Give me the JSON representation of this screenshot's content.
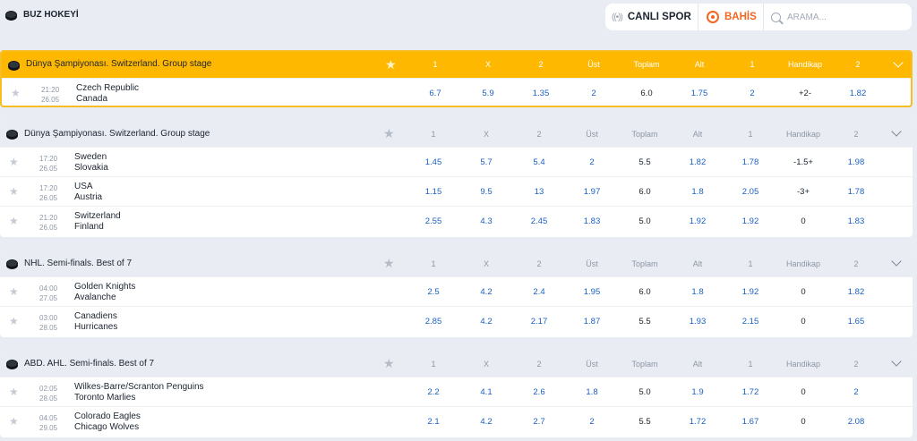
{
  "header": {
    "sport": "BUZ HOKEYİ",
    "live_label": "CANLI SPOR",
    "bet_label": "BAHİS",
    "search_placeholder": "ARAMA..."
  },
  "columns": [
    "1",
    "X",
    "2",
    "Üst",
    "Toplam",
    "Alt",
    "1",
    "Handikap",
    "2"
  ],
  "leagues": [
    {
      "name": "Dünya Şampiyonası. Switzerland. Group stage",
      "events": [
        {
          "time": "21:20",
          "date": "26.05",
          "home": "Czech Republic",
          "away": "Canada",
          "odds": [
            "6.7",
            "5.9",
            "1.35",
            "2",
            "6.0",
            "1.75",
            "2",
            "+2-",
            "1.82"
          ]
        }
      ]
    },
    {
      "name": "Dünya Şampiyonası. Switzerland. Group stage",
      "events": [
        {
          "time": "17:20",
          "date": "26.05",
          "home": "Sweden",
          "away": "Slovakia",
          "odds": [
            "1.45",
            "5.7",
            "5.4",
            "2",
            "5.5",
            "1.82",
            "1.78",
            "-1.5+",
            "1.98"
          ]
        },
        {
          "time": "17:20",
          "date": "26.05",
          "home": "USA",
          "away": "Austria",
          "odds": [
            "1.15",
            "9.5",
            "13",
            "1.97",
            "6.0",
            "1.8",
            "2.05",
            "-3+",
            "1.78"
          ]
        },
        {
          "time": "21:20",
          "date": "26.05",
          "home": "Switzerland",
          "away": "Finland",
          "odds": [
            "2.55",
            "4.3",
            "2.45",
            "1.83",
            "5.0",
            "1.92",
            "1.92",
            "0",
            "1.83"
          ]
        }
      ]
    },
    {
      "name": "NHL. Semi-finals. Best of 7",
      "events": [
        {
          "time": "04:00",
          "date": "27.05",
          "home": "Golden Knights",
          "away": "Avalanche",
          "odds": [
            "2.5",
            "4.2",
            "2.4",
            "1.95",
            "6.0",
            "1.8",
            "1.92",
            "0",
            "1.82"
          ]
        },
        {
          "time": "03:00",
          "date": "28.05",
          "home": "Canadiens",
          "away": "Hurricanes",
          "odds": [
            "2.85",
            "4.2",
            "2.17",
            "1.87",
            "5.5",
            "1.93",
            "2.15",
            "0",
            "1.65"
          ]
        }
      ]
    },
    {
      "name": "ABD. AHL. Semi-finals. Best of 7",
      "events": [
        {
          "time": "02:05",
          "date": "28.05",
          "home": "Wilkes-Barre/Scranton Penguins",
          "away": "Toronto Marlies",
          "odds": [
            "2.2",
            "4.1",
            "2.6",
            "1.8",
            "5.0",
            "1.9",
            "1.72",
            "0",
            "2"
          ]
        },
        {
          "time": "04:05",
          "date": "29.05",
          "home": "Colorado Eagles",
          "away": "Chicago Wolves",
          "odds": [
            "2.1",
            "4.2",
            "2.7",
            "2",
            "5.5",
            "1.72",
            "1.67",
            "0",
            "2.08"
          ]
        }
      ]
    }
  ]
}
